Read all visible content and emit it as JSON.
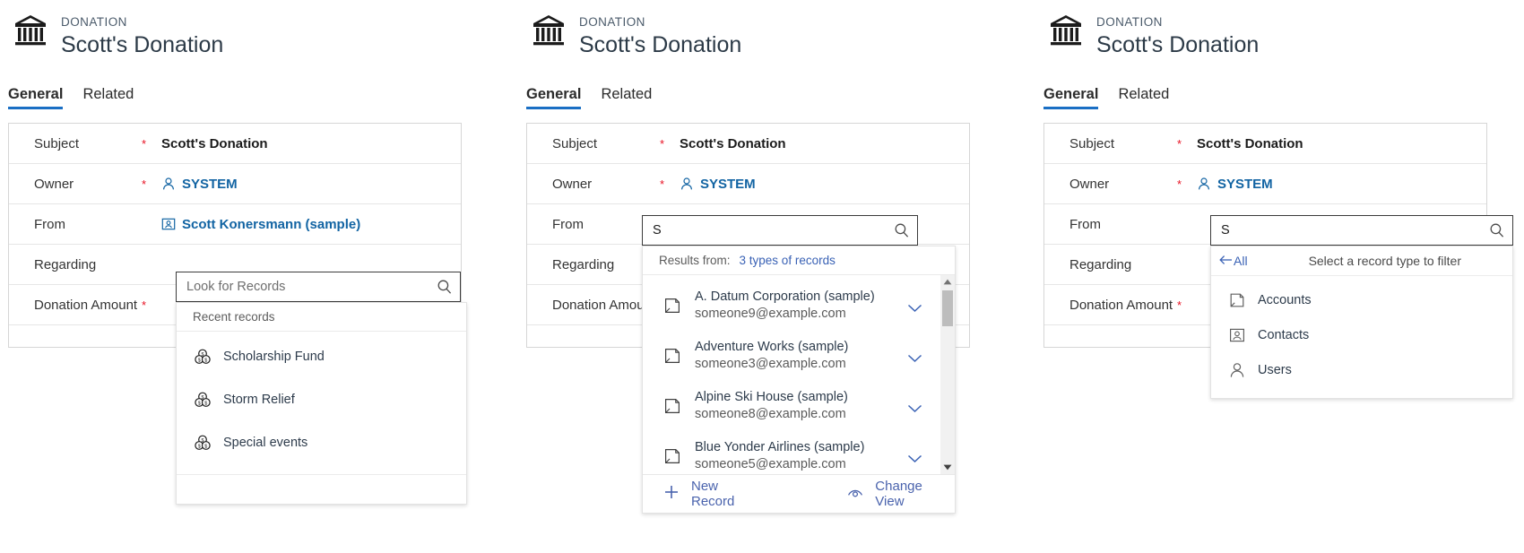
{
  "record": {
    "entity_kind": "DONATION",
    "title": "Scott's Donation",
    "icon": "bank-donation-icon"
  },
  "tabs": [
    {
      "label": "General",
      "active": true
    },
    {
      "label": "Related",
      "active": false
    }
  ],
  "fields": {
    "subject": {
      "label": "Subject",
      "required": "*",
      "value": "Scott's Donation"
    },
    "owner": {
      "label": "Owner",
      "required": "*",
      "value": "SYSTEM",
      "icon": "user-icon"
    },
    "from": {
      "label": "From",
      "required": "",
      "value": "Scott Konersmann (sample)",
      "icon": "contact-card-icon"
    },
    "regarding": {
      "label": "Regarding",
      "required": ""
    },
    "donation_amount": {
      "label": "Donation Amount",
      "required": "*",
      "value": ""
    }
  },
  "panel1": {
    "lookup": {
      "placeholder": "Look for Records",
      "value": "",
      "icon": "search-icon"
    },
    "flyout": {
      "header": "Recent records",
      "items": [
        {
          "label": "Scholarship Fund",
          "icon": "coins-icon"
        },
        {
          "label": "Storm Relief",
          "icon": "coins-icon"
        },
        {
          "label": "Special events",
          "icon": "coins-icon"
        }
      ]
    }
  },
  "panel2": {
    "lookup": {
      "placeholder": "",
      "value": "S",
      "icon": "search-icon"
    },
    "flyout": {
      "results_from_label": "Results from:",
      "results_from_value": "3 types of records",
      "results": [
        {
          "name": "A. Datum Corporation (sample)",
          "email": "someone9@example.com",
          "icon": "account-icon",
          "expander": "chevron-down-icon"
        },
        {
          "name": "Adventure Works (sample)",
          "email": "someone3@example.com",
          "icon": "account-icon",
          "expander": "chevron-down-icon"
        },
        {
          "name": "Alpine Ski House (sample)",
          "email": "someone8@example.com",
          "icon": "account-icon",
          "expander": "chevron-down-icon"
        },
        {
          "name": "Blue Yonder Airlines (sample)",
          "email": "someone5@example.com",
          "icon": "account-icon",
          "expander": "chevron-down-icon"
        }
      ],
      "footer": {
        "new_record": "New Record",
        "new_record_icon": "plus-icon",
        "change_view": "Change View",
        "change_view_icon": "eye-icon"
      }
    }
  },
  "panel3": {
    "lookup": {
      "placeholder": "",
      "value": "S",
      "icon": "search-icon"
    },
    "flyout": {
      "back_label": "All",
      "back_icon": "arrow-left-icon",
      "hint": "Select a record type to filter",
      "types": [
        {
          "label": "Accounts",
          "icon": "account-icon"
        },
        {
          "label": "Contacts",
          "icon": "contact-card-icon"
        },
        {
          "label": "Users",
          "icon": "user-icon"
        }
      ]
    }
  },
  "colors": {
    "accent_blue": "#1a6fc4",
    "link_blue": "#1264a3",
    "flyout_link": "#3a62b5",
    "required_red": "#e81123",
    "title_gray": "#2c3a47"
  }
}
